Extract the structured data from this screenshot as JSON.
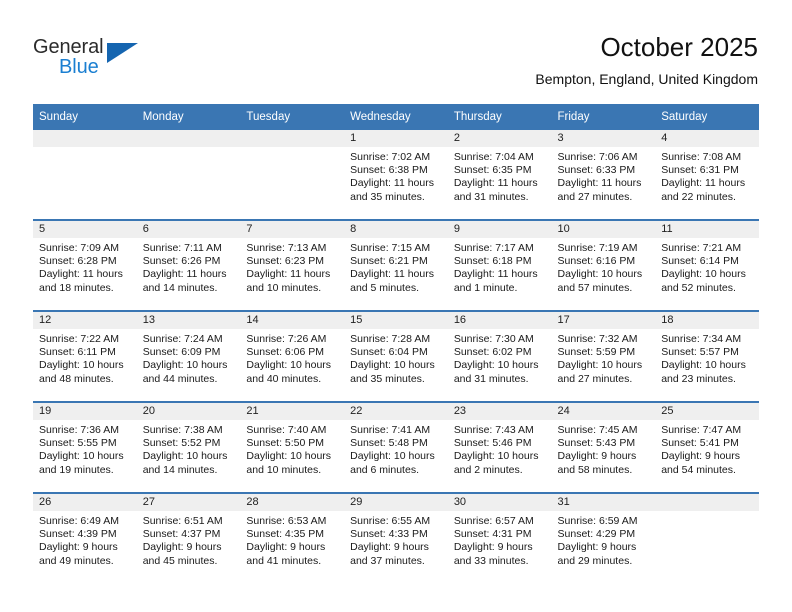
{
  "logo": {
    "word_one": "General",
    "word_two": "Blue",
    "triangle_color": "#1565b0"
  },
  "header": {
    "title": "October 2025",
    "subtitle": "Bempton, England, United Kingdom",
    "accent_color": "#3a76b3",
    "daynum_band_color": "#efefef"
  },
  "weekdays": [
    "Sunday",
    "Monday",
    "Tuesday",
    "Wednesday",
    "Thursday",
    "Friday",
    "Saturday"
  ],
  "weeks": [
    [
      {
        "day": "",
        "sunrise": "",
        "sunset": "",
        "daylight": ""
      },
      {
        "day": "",
        "sunrise": "",
        "sunset": "",
        "daylight": ""
      },
      {
        "day": "",
        "sunrise": "",
        "sunset": "",
        "daylight": ""
      },
      {
        "day": "1",
        "sunrise": "Sunrise: 7:02 AM",
        "sunset": "Sunset: 6:38 PM",
        "daylight": "Daylight: 11 hours and 35 minutes."
      },
      {
        "day": "2",
        "sunrise": "Sunrise: 7:04 AM",
        "sunset": "Sunset: 6:35 PM",
        "daylight": "Daylight: 11 hours and 31 minutes."
      },
      {
        "day": "3",
        "sunrise": "Sunrise: 7:06 AM",
        "sunset": "Sunset: 6:33 PM",
        "daylight": "Daylight: 11 hours and 27 minutes."
      },
      {
        "day": "4",
        "sunrise": "Sunrise: 7:08 AM",
        "sunset": "Sunset: 6:31 PM",
        "daylight": "Daylight: 11 hours and 22 minutes."
      }
    ],
    [
      {
        "day": "5",
        "sunrise": "Sunrise: 7:09 AM",
        "sunset": "Sunset: 6:28 PM",
        "daylight": "Daylight: 11 hours and 18 minutes."
      },
      {
        "day": "6",
        "sunrise": "Sunrise: 7:11 AM",
        "sunset": "Sunset: 6:26 PM",
        "daylight": "Daylight: 11 hours and 14 minutes."
      },
      {
        "day": "7",
        "sunrise": "Sunrise: 7:13 AM",
        "sunset": "Sunset: 6:23 PM",
        "daylight": "Daylight: 11 hours and 10 minutes."
      },
      {
        "day": "8",
        "sunrise": "Sunrise: 7:15 AM",
        "sunset": "Sunset: 6:21 PM",
        "daylight": "Daylight: 11 hours and 5 minutes."
      },
      {
        "day": "9",
        "sunrise": "Sunrise: 7:17 AM",
        "sunset": "Sunset: 6:18 PM",
        "daylight": "Daylight: 11 hours and 1 minute."
      },
      {
        "day": "10",
        "sunrise": "Sunrise: 7:19 AM",
        "sunset": "Sunset: 6:16 PM",
        "daylight": "Daylight: 10 hours and 57 minutes."
      },
      {
        "day": "11",
        "sunrise": "Sunrise: 7:21 AM",
        "sunset": "Sunset: 6:14 PM",
        "daylight": "Daylight: 10 hours and 52 minutes."
      }
    ],
    [
      {
        "day": "12",
        "sunrise": "Sunrise: 7:22 AM",
        "sunset": "Sunset: 6:11 PM",
        "daylight": "Daylight: 10 hours and 48 minutes."
      },
      {
        "day": "13",
        "sunrise": "Sunrise: 7:24 AM",
        "sunset": "Sunset: 6:09 PM",
        "daylight": "Daylight: 10 hours and 44 minutes."
      },
      {
        "day": "14",
        "sunrise": "Sunrise: 7:26 AM",
        "sunset": "Sunset: 6:06 PM",
        "daylight": "Daylight: 10 hours and 40 minutes."
      },
      {
        "day": "15",
        "sunrise": "Sunrise: 7:28 AM",
        "sunset": "Sunset: 6:04 PM",
        "daylight": "Daylight: 10 hours and 35 minutes."
      },
      {
        "day": "16",
        "sunrise": "Sunrise: 7:30 AM",
        "sunset": "Sunset: 6:02 PM",
        "daylight": "Daylight: 10 hours and 31 minutes."
      },
      {
        "day": "17",
        "sunrise": "Sunrise: 7:32 AM",
        "sunset": "Sunset: 5:59 PM",
        "daylight": "Daylight: 10 hours and 27 minutes."
      },
      {
        "day": "18",
        "sunrise": "Sunrise: 7:34 AM",
        "sunset": "Sunset: 5:57 PM",
        "daylight": "Daylight: 10 hours and 23 minutes."
      }
    ],
    [
      {
        "day": "19",
        "sunrise": "Sunrise: 7:36 AM",
        "sunset": "Sunset: 5:55 PM",
        "daylight": "Daylight: 10 hours and 19 minutes."
      },
      {
        "day": "20",
        "sunrise": "Sunrise: 7:38 AM",
        "sunset": "Sunset: 5:52 PM",
        "daylight": "Daylight: 10 hours and 14 minutes."
      },
      {
        "day": "21",
        "sunrise": "Sunrise: 7:40 AM",
        "sunset": "Sunset: 5:50 PM",
        "daylight": "Daylight: 10 hours and 10 minutes."
      },
      {
        "day": "22",
        "sunrise": "Sunrise: 7:41 AM",
        "sunset": "Sunset: 5:48 PM",
        "daylight": "Daylight: 10 hours and 6 minutes."
      },
      {
        "day": "23",
        "sunrise": "Sunrise: 7:43 AM",
        "sunset": "Sunset: 5:46 PM",
        "daylight": "Daylight: 10 hours and 2 minutes."
      },
      {
        "day": "24",
        "sunrise": "Sunrise: 7:45 AM",
        "sunset": "Sunset: 5:43 PM",
        "daylight": "Daylight: 9 hours and 58 minutes."
      },
      {
        "day": "25",
        "sunrise": "Sunrise: 7:47 AM",
        "sunset": "Sunset: 5:41 PM",
        "daylight": "Daylight: 9 hours and 54 minutes."
      }
    ],
    [
      {
        "day": "26",
        "sunrise": "Sunrise: 6:49 AM",
        "sunset": "Sunset: 4:39 PM",
        "daylight": "Daylight: 9 hours and 49 minutes."
      },
      {
        "day": "27",
        "sunrise": "Sunrise: 6:51 AM",
        "sunset": "Sunset: 4:37 PM",
        "daylight": "Daylight: 9 hours and 45 minutes."
      },
      {
        "day": "28",
        "sunrise": "Sunrise: 6:53 AM",
        "sunset": "Sunset: 4:35 PM",
        "daylight": "Daylight: 9 hours and 41 minutes."
      },
      {
        "day": "29",
        "sunrise": "Sunrise: 6:55 AM",
        "sunset": "Sunset: 4:33 PM",
        "daylight": "Daylight: 9 hours and 37 minutes."
      },
      {
        "day": "30",
        "sunrise": "Sunrise: 6:57 AM",
        "sunset": "Sunset: 4:31 PM",
        "daylight": "Daylight: 9 hours and 33 minutes."
      },
      {
        "day": "31",
        "sunrise": "Sunrise: 6:59 AM",
        "sunset": "Sunset: 4:29 PM",
        "daylight": "Daylight: 9 hours and 29 minutes."
      },
      {
        "day": "",
        "sunrise": "",
        "sunset": "",
        "daylight": ""
      }
    ]
  ]
}
